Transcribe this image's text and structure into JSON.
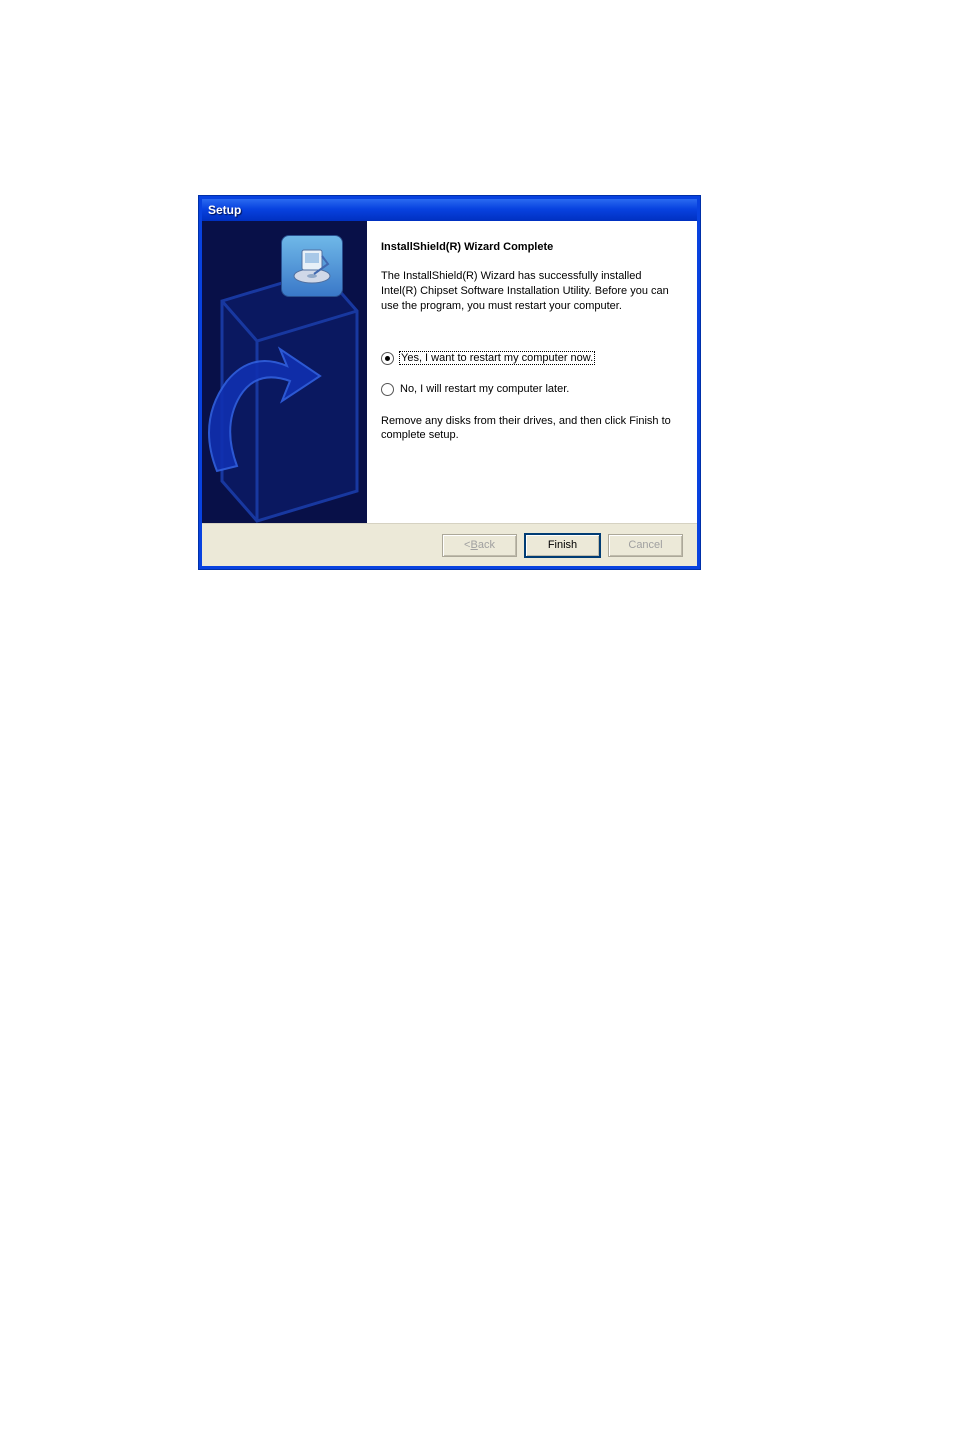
{
  "titlebar": {
    "text": "Setup"
  },
  "main": {
    "heading": "InstallShield(R) Wizard Complete",
    "description": "The InstallShield(R) Wizard has successfully installed Intel(R) Chipset Software Installation Utility.  Before you can use the program, you must restart your computer.",
    "options": {
      "restart_now": {
        "label": "Yes, I want to restart my computer now.",
        "selected": true
      },
      "restart_later": {
        "label": "No, I will restart my computer later.",
        "selected": false
      }
    },
    "footer_note": "Remove any disks from their drives, and then click Finish to complete setup."
  },
  "buttons": {
    "back_prefix": "< ",
    "back_letter": "B",
    "back_rest": "ack",
    "finish": "Finish",
    "cancel": "Cancel"
  }
}
